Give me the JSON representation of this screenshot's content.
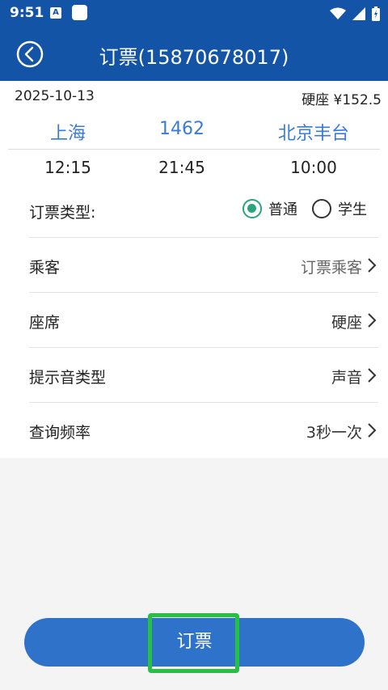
{
  "status_bar": {
    "time": "9:51",
    "notif_letter": "A"
  },
  "app_bar": {
    "title": "订票(15870678017)"
  },
  "trip": {
    "date": "2025-10-13",
    "seat_price": "硬座 ¥152.5",
    "from_station": "上海",
    "train_no": "1462",
    "to_station": "北京丰台",
    "depart_time": "12:15",
    "arrive_time": "21:45",
    "duration": "10:00"
  },
  "form": {
    "ticket_type": {
      "label": "订票类型:",
      "options": [
        "普通",
        "学生"
      ],
      "selected": "普通"
    },
    "passenger": {
      "label": "乘客",
      "value": "订票乘客"
    },
    "seat": {
      "label": "座席",
      "value": "硬座"
    },
    "alert_sound": {
      "label": "提示音类型",
      "value": "声音"
    },
    "query_rate": {
      "label": "查询频率",
      "value": "3秒一次"
    }
  },
  "actions": {
    "order_label": "订票"
  },
  "colors": {
    "primary": "#1454a6",
    "accent_blue": "#3a7ad8",
    "radio_green": "#2aa57a",
    "highlight_green": "#26c043",
    "button_blue": "#2f72c9"
  }
}
